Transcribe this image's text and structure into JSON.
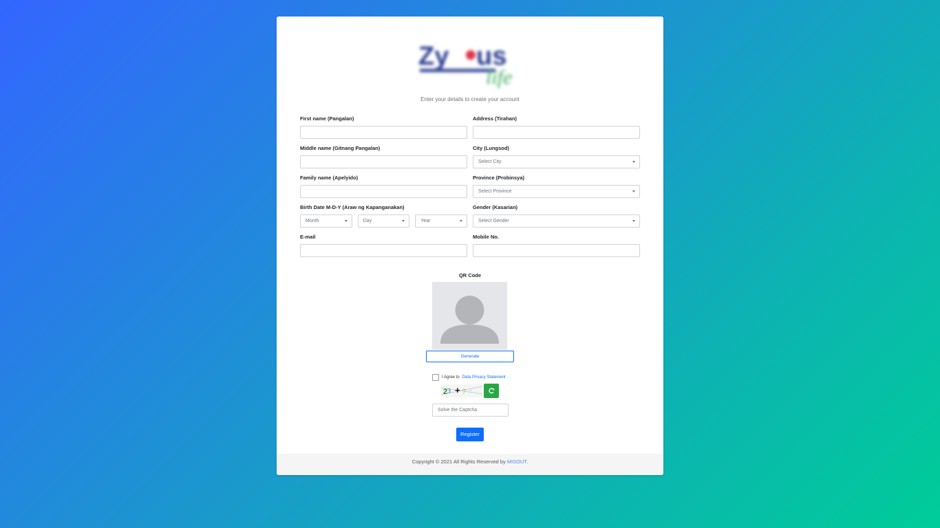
{
  "brand": {
    "subtitle": "Enter your details to create your account"
  },
  "form": {
    "first_name": {
      "label": "First name (Pangalan)",
      "value": ""
    },
    "middle_name": {
      "label": "Middle name (Gitnang Pangalan)",
      "value": ""
    },
    "family_name": {
      "label": "Family name (Apelyido)",
      "value": ""
    },
    "birth_date": {
      "label": "Birth Date M-D-Y (Araw ng Kapanganakan)",
      "month": "Month",
      "day": "Day",
      "year": "Year"
    },
    "email": {
      "label": "E-mail",
      "value": ""
    },
    "address": {
      "label": "Address (Tirahan)",
      "value": ""
    },
    "city": {
      "label": "City (Lungsod)",
      "selected": "Select City"
    },
    "province": {
      "label": "Province (Probinsya)",
      "selected": "Select Province"
    },
    "gender": {
      "label": "Gender (Kasarian)",
      "selected": "Select Gender"
    },
    "mobile": {
      "label": "Mobile No.",
      "value": ""
    }
  },
  "qr": {
    "label": "QR Code",
    "generate_label": "Generate"
  },
  "agreement": {
    "prefix": "I Agree to",
    "link_text": "Data Privacy Statement",
    "suffix": "."
  },
  "captcha": {
    "placeholder": "Solve the Captcha",
    "refresh_icon": "refresh-icon"
  },
  "register_label": "Register",
  "footer": {
    "prefix": "Copyright © 2021 All Rights Reserved by",
    "link_text": "MISOUT",
    "suffix": "."
  },
  "colors": {
    "primary": "#0d6efd",
    "success": "#28a745",
    "gradient_start": "#3366ff",
    "gradient_end": "#00cc99"
  }
}
